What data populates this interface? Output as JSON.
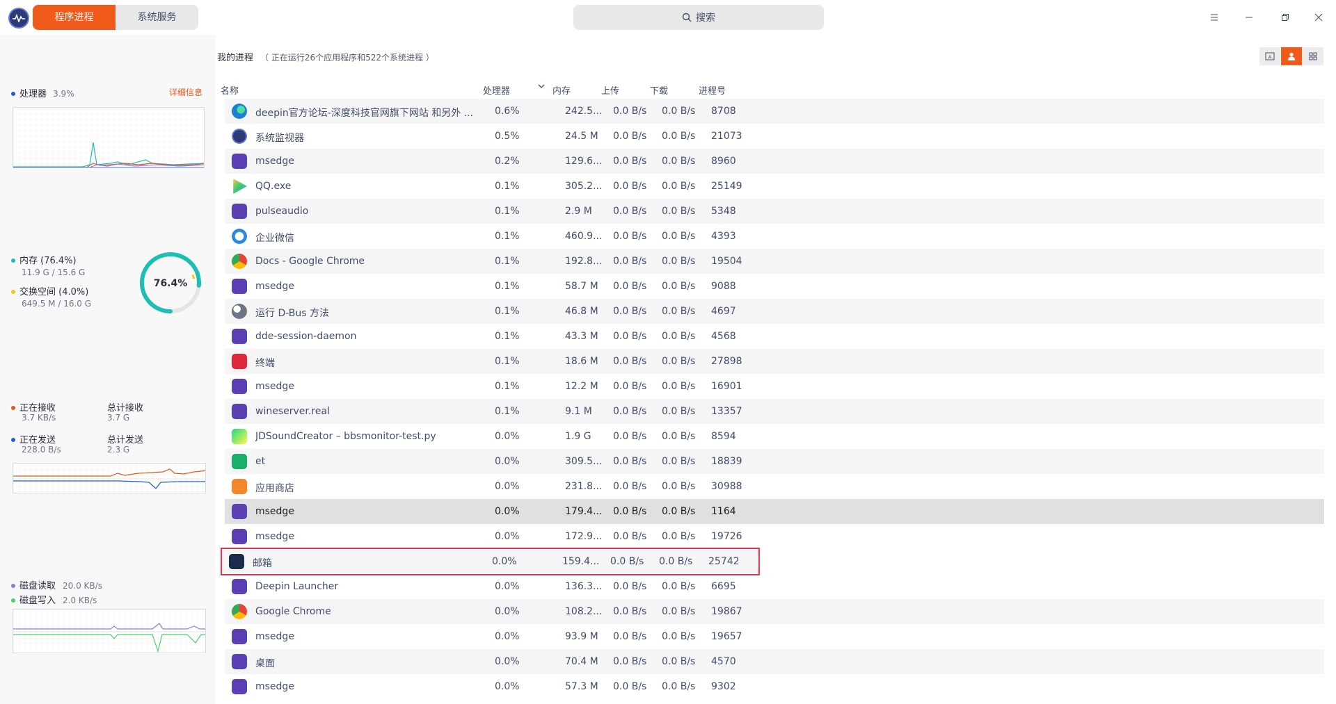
{
  "titlebar": {
    "tabs": [
      {
        "label": "程序进程",
        "active": true
      },
      {
        "label": "系统服务",
        "active": false
      }
    ],
    "search_placeholder": "搜索"
  },
  "left": {
    "cpu": {
      "label": "处理器",
      "value": "3.9%",
      "detail_link": "详细信息"
    },
    "memory": {
      "label": "内存 (76.4%)",
      "usage": "11.9 G / 15.6 G",
      "percent_text": "76.4%",
      "percent": 0.764
    },
    "swap": {
      "label": "交换空间 (4.0%)",
      "usage": "649.5 M / 16.0 G"
    },
    "network": {
      "receiving_label": "正在接收",
      "receiving_value": "3.7 KB/s",
      "total_recv_label": "总计接收",
      "total_recv_value": "3.7 G",
      "sending_label": "正在发送",
      "sending_value": "228.0 B/s",
      "total_sent_label": "总计发送",
      "total_sent_value": "2.3 G"
    },
    "disk": {
      "read_label": "磁盘读取",
      "read_value": "20.0 KB/s",
      "write_label": "磁盘写入",
      "write_value": "2.0 KB/s"
    }
  },
  "main": {
    "title": "我的进程",
    "subtitle": "（ 正在运行26个应用程序和522个系统进程 ）",
    "columns": {
      "name": "名称",
      "cpu": "处理器",
      "mem": "内存",
      "up": "上传",
      "down": "下载",
      "pid": "进程号"
    },
    "rows": [
      {
        "name": "deepin官方论坛-深度科技官网旗下网站 和另外 ...",
        "cpu": "0.6%",
        "mem": "242.5...",
        "up": "0.0 B/s",
        "down": "0.0 B/s",
        "pid": "8708",
        "icon": "edge-icon"
      },
      {
        "name": "系统监视器",
        "cpu": "0.5%",
        "mem": "24.5 M",
        "up": "0.0 B/s",
        "down": "0.0 B/s",
        "pid": "21073",
        "icon": "system-monitor-icon"
      },
      {
        "name": "msedge",
        "cpu": "0.2%",
        "mem": "129.6...",
        "up": "0.0 B/s",
        "down": "0.0 B/s",
        "pid": "8960",
        "icon": "process-icon"
      },
      {
        "name": "QQ.exe",
        "cpu": "0.1%",
        "mem": "305.2...",
        "up": "0.0 B/s",
        "down": "0.0 B/s",
        "pid": "25149",
        "icon": "qq-icon"
      },
      {
        "name": "pulseaudio",
        "cpu": "0.1%",
        "mem": "2.9 M",
        "up": "0.0 B/s",
        "down": "0.0 B/s",
        "pid": "5348",
        "icon": "process-icon"
      },
      {
        "name": "企业微信",
        "cpu": "0.1%",
        "mem": "460.9...",
        "up": "0.0 B/s",
        "down": "0.0 B/s",
        "pid": "4393",
        "icon": "wecom-icon"
      },
      {
        "name": "Docs - Google Chrome",
        "cpu": "0.1%",
        "mem": "192.8...",
        "up": "0.0 B/s",
        "down": "0.0 B/s",
        "pid": "19504",
        "icon": "chrome-icon"
      },
      {
        "name": "msedge",
        "cpu": "0.1%",
        "mem": "58.7 M",
        "up": "0.0 B/s",
        "down": "0.0 B/s",
        "pid": "9088",
        "icon": "process-icon"
      },
      {
        "name": "运行 D-Bus 方法",
        "cpu": "0.1%",
        "mem": "46.8 M",
        "up": "0.0 B/s",
        "down": "0.0 B/s",
        "pid": "4697",
        "icon": "dbus-icon"
      },
      {
        "name": "dde-session-daemon",
        "cpu": "0.1%",
        "mem": "43.3 M",
        "up": "0.0 B/s",
        "down": "0.0 B/s",
        "pid": "4568",
        "icon": "process-icon"
      },
      {
        "name": "终端",
        "cpu": "0.1%",
        "mem": "18.6 M",
        "up": "0.0 B/s",
        "down": "0.0 B/s",
        "pid": "27898",
        "icon": "terminal-icon"
      },
      {
        "name": "msedge",
        "cpu": "0.1%",
        "mem": "12.2 M",
        "up": "0.0 B/s",
        "down": "0.0 B/s",
        "pid": "16901",
        "icon": "process-icon"
      },
      {
        "name": "wineserver.real",
        "cpu": "0.1%",
        "mem": "9.1 M",
        "up": "0.0 B/s",
        "down": "0.0 B/s",
        "pid": "13357",
        "icon": "process-icon"
      },
      {
        "name": "JDSoundCreator – bbsmonitor-test.py",
        "cpu": "0.0%",
        "mem": "1.9 G",
        "up": "0.0 B/s",
        "down": "0.0 B/s",
        "pid": "8594",
        "icon": "pycharm-icon"
      },
      {
        "name": "et",
        "cpu": "0.0%",
        "mem": "309.5...",
        "up": "0.0 B/s",
        "down": "0.0 B/s",
        "pid": "18839",
        "icon": "wps-et-icon"
      },
      {
        "name": "应用商店",
        "cpu": "0.0%",
        "mem": "231.8...",
        "up": "0.0 B/s",
        "down": "0.0 B/s",
        "pid": "30988",
        "icon": "app-store-icon"
      },
      {
        "name": "msedge",
        "cpu": "0.0%",
        "mem": "179.4...",
        "up": "0.0 B/s",
        "down": "0.0 B/s",
        "pid": "1164",
        "icon": "process-icon",
        "selected": true
      },
      {
        "name": "msedge",
        "cpu": "0.0%",
        "mem": "172.9...",
        "up": "0.0 B/s",
        "down": "0.0 B/s",
        "pid": "19726",
        "icon": "process-icon"
      },
      {
        "name": "邮箱",
        "cpu": "0.0%",
        "mem": "159.4...",
        "up": "0.0 B/s",
        "down": "0.0 B/s",
        "pid": "25742",
        "icon": "mail-icon",
        "highlight": true
      },
      {
        "name": "Deepin Launcher",
        "cpu": "0.0%",
        "mem": "136.3...",
        "up": "0.0 B/s",
        "down": "0.0 B/s",
        "pid": "6695",
        "icon": "process-icon"
      },
      {
        "name": "Google Chrome",
        "cpu": "0.0%",
        "mem": "108.2...",
        "up": "0.0 B/s",
        "down": "0.0 B/s",
        "pid": "19867",
        "icon": "chrome-icon"
      },
      {
        "name": "msedge",
        "cpu": "0.0%",
        "mem": "93.9 M",
        "up": "0.0 B/s",
        "down": "0.0 B/s",
        "pid": "19657",
        "icon": "process-icon"
      },
      {
        "name": "桌面",
        "cpu": "0.0%",
        "mem": "70.4 M",
        "up": "0.0 B/s",
        "down": "0.0 B/s",
        "pid": "4570",
        "icon": "process-icon"
      },
      {
        "name": "msedge",
        "cpu": "0.0%",
        "mem": "57.3 M",
        "up": "0.0 B/s",
        "down": "0.0 B/s",
        "pid": "9302",
        "icon": "process-icon"
      }
    ]
  },
  "colors": {
    "accent": "#f05a1a",
    "highlight_border": "#e8344f",
    "memory_ring": "#1dbfb3",
    "swap_dot": "#f4c515",
    "recv": "#e4581c",
    "send": "#1f5bd6",
    "disk_read": "#8c7ce0",
    "disk_write": "#4bd06e"
  }
}
